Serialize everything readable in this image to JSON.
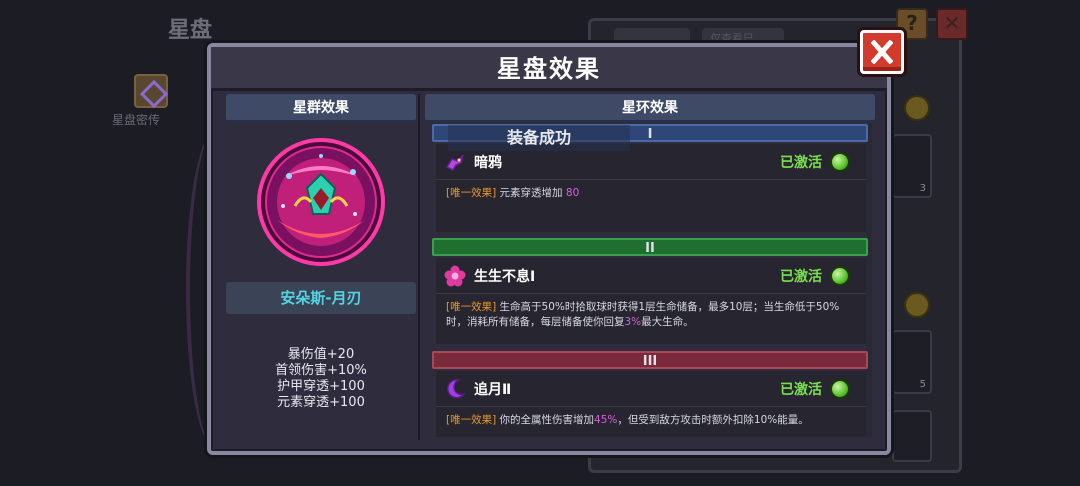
{
  "background": {
    "title": "星盘",
    "side_label": "星盘密传",
    "tabs": [
      "",
      "仅查看已"
    ],
    "help_label": "?",
    "slot_counts": [
      "3",
      "5"
    ]
  },
  "modal": {
    "title": "星盘效果",
    "close_label": "✕"
  },
  "left": {
    "header": "星群效果",
    "name": "安朵斯-月刃",
    "stats": [
      "暴伤值+20",
      "首领伤害+10%",
      "护甲穿透+100",
      "元素穿透+100"
    ]
  },
  "right": {
    "header": "星环效果",
    "toast": "装备成功",
    "rings": [
      {
        "numeral": "I",
        "name": "暗鸦",
        "status": "已激活",
        "tag": "[唯一效果]",
        "desc_a": "元素穿透增加",
        "highlight": "80",
        "desc_b": ""
      },
      {
        "numeral": "II",
        "name": "生生不息Ⅰ",
        "status": "已激活",
        "tag": "[唯一效果]",
        "desc_a": "生命高于50%时拾取球时获得1层生命储备，最多10层；当生命低于50%时，消耗所有储备，每层储备使你回复",
        "highlight": "3%",
        "desc_b": "最大生命。"
      },
      {
        "numeral": "III",
        "name": "追月Ⅱ",
        "status": "已激活",
        "tag": "[唯一效果]",
        "desc_a": "你的全属性伤害增加",
        "highlight": "45%",
        "desc_b": "，但受到敌方攻击时额外扣除10%能量。"
      }
    ]
  },
  "colors": {
    "accent_active": "#7ae050",
    "name_cyan": "#52d4e2",
    "tag_orange": "#e89a2a",
    "highlight_magenta": "#d860e0",
    "ring1": "#2e4778",
    "ring2": "#1f7030",
    "ring3": "#7a2a3a"
  },
  "icons": {
    "close": "close-x-icon",
    "emblem": "star-disk-emblem-icon",
    "ring1": "crow-icon",
    "ring2": "flower-icon",
    "ring3": "crescent-moon-icon",
    "active": "active-orb-icon"
  }
}
